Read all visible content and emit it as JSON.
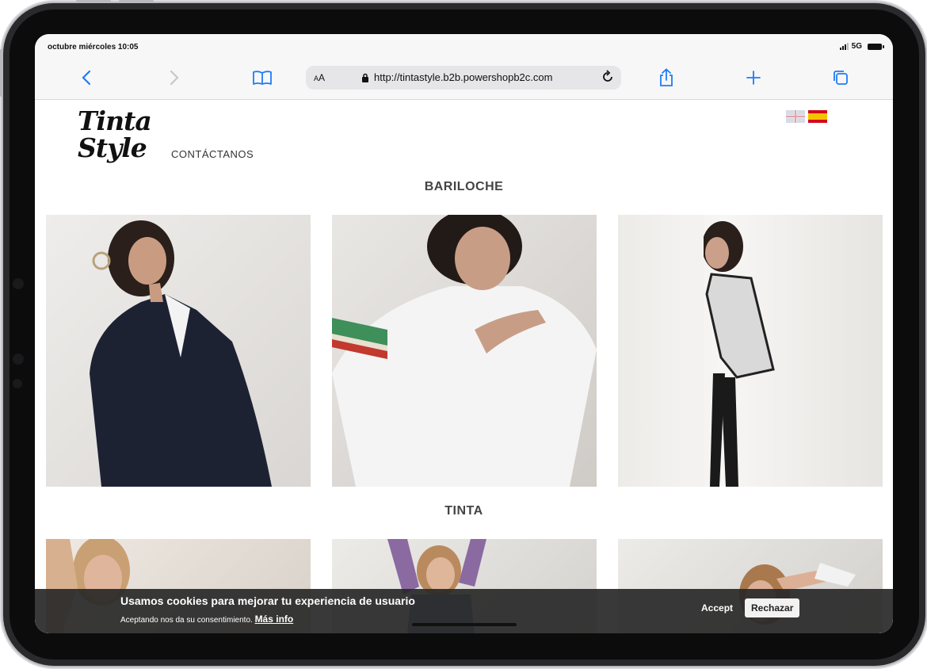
{
  "status_bar": {
    "time": "octubre miércoles 10:05",
    "network": "5G"
  },
  "browser": {
    "text_size_label_small": "A",
    "text_size_label": "A",
    "url": "http://tintastyle.b2b.powershopb2c.com"
  },
  "site": {
    "logo_line1": "Tinta",
    "logo_line2": "Style",
    "nav_contact": "CONTÁCTANOS",
    "sections": [
      {
        "title": "BARILOCHE"
      },
      {
        "title": "TINTA"
      }
    ]
  },
  "cookie_banner": {
    "headline": "Usamos cookies para mejorar tu experiencia de usuario",
    "body": "Aceptando nos da su consentimiento.",
    "more_link": "Más info",
    "accept_label": "Accept",
    "reject_label": "Rechazar"
  },
  "colors": {
    "flag_es_red": "#d20a1a",
    "flag_es_yellow": "#f5c400",
    "accent_blue": "#1f7cf5"
  }
}
